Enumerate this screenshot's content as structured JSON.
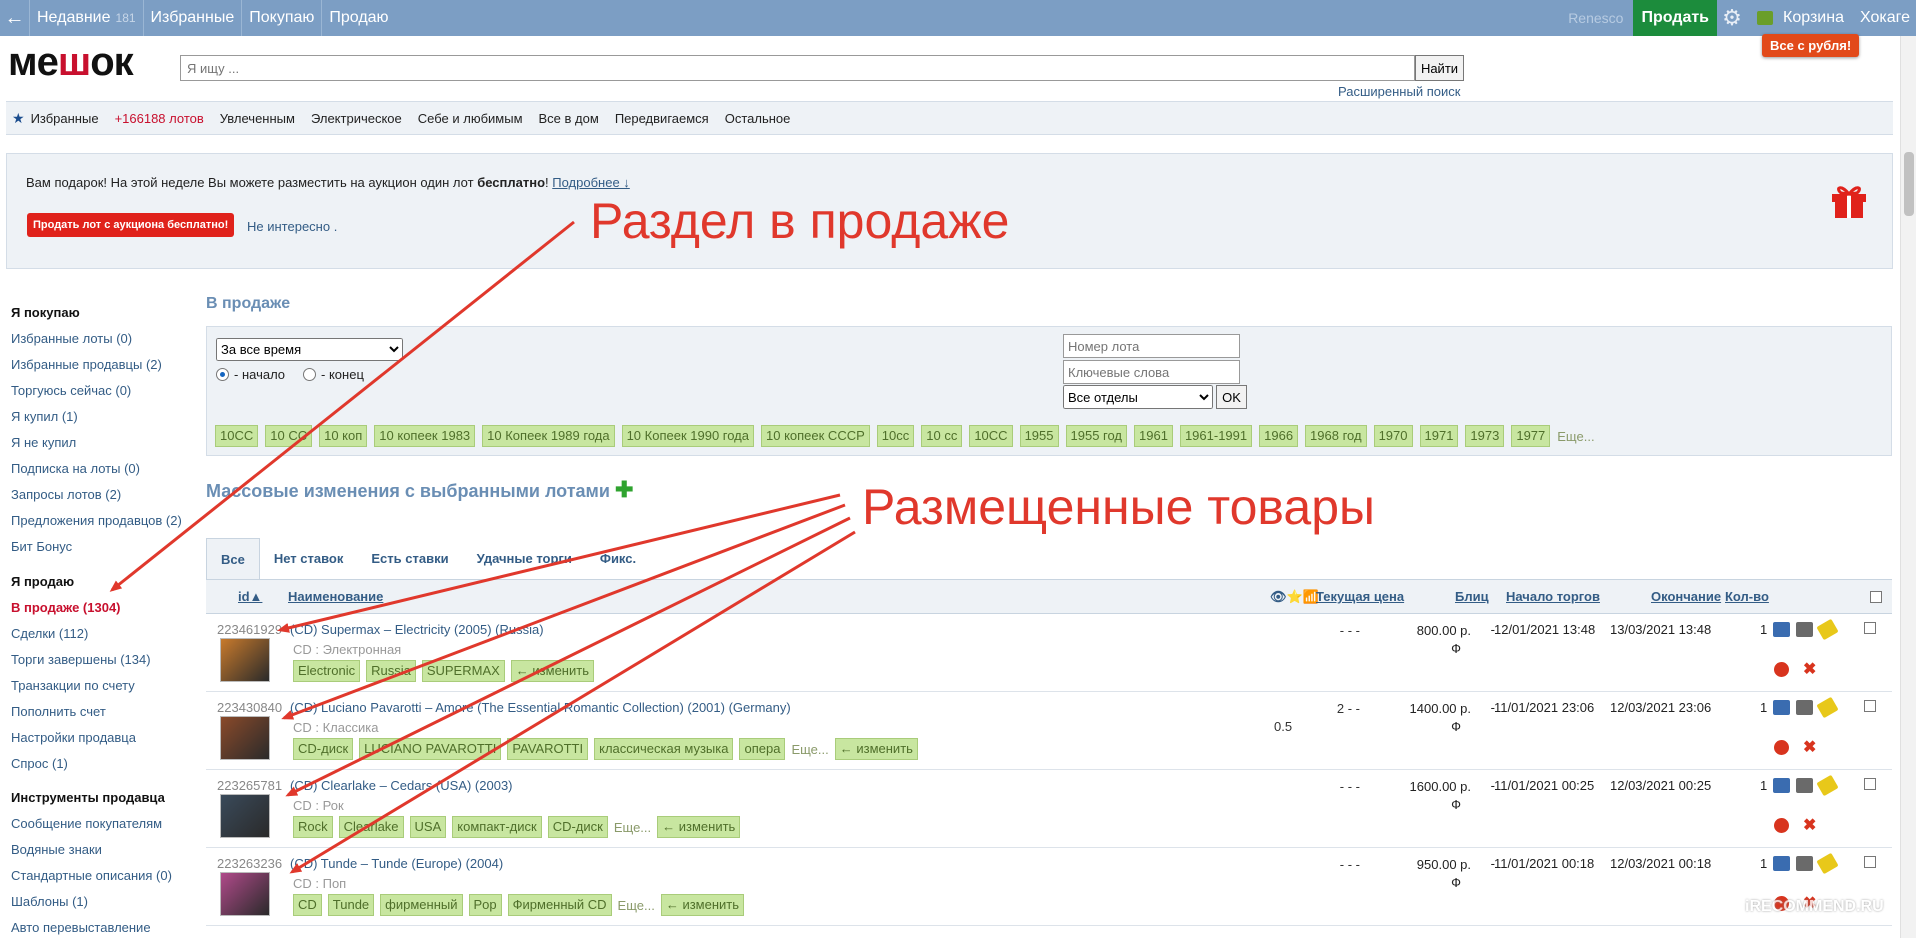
{
  "topbar": {
    "recent": "Недавние",
    "recent_count": "181",
    "favorites": "Избранные",
    "buying": "Покупаю",
    "selling": "Продаю",
    "user": "Renesco",
    "sell_button": "Продать",
    "cart": "Корзина",
    "xokare": "Хокаге"
  },
  "promo_badge": "Все с рубля!",
  "logo": {
    "pre": "ме",
    "mid": "ш",
    "post": "ок"
  },
  "search": {
    "placeholder": "Я ищу ...",
    "button": "Найти",
    "advanced": "Расширенный поиск"
  },
  "categories": {
    "favorites": "Избранные",
    "lots_count": "+166188 лотов",
    "items": [
      "Увлеченным",
      "Электрическое",
      "Себе и любимым",
      "Все в дом",
      "Передвигаемся",
      "Остальное"
    ]
  },
  "banner": {
    "text_a": "Вам подарок! На этой неделе Вы можете разместить на аукцион один лот ",
    "text_b": "бесплатно",
    "text_c": "! ",
    "more": "Подробнее ↓",
    "button": "Продать лот с аукциона бесплатно!",
    "not_interested": "Не интересно ."
  },
  "sidebar": {
    "buy_header": "Я покупаю",
    "buy_items": [
      "Избранные лоты (0)",
      "Избранные продавцы (2)",
      "Торгуюсь сейчас (0)",
      "Я купил (1)",
      "Я не купил",
      "Подписка на лоты (0)",
      "Запросы лотов (2)",
      "Предложения продавцов (2)",
      "Бит Бонус"
    ],
    "sell_header": "Я продаю",
    "sell_active": "В продаже (1304)",
    "sell_items": [
      "Сделки (112)",
      "Торги завершены (134)",
      "Транзакции по счету",
      "Пополнить счет",
      "Настройки продавца",
      "Спрос (1)"
    ],
    "tools_header": "Инструменты продавца",
    "tools_items": [
      "Сообщение покупателям",
      "Водяные знаки",
      "Стандартные описания (0)",
      "Шаблоны (1)",
      "Авто перевыставление"
    ]
  },
  "page_title": "В продаже",
  "filter": {
    "period": "За все время",
    "radio_start": "- начало",
    "radio_end": "- конец",
    "lot_placeholder": "Номер лота",
    "keywords_placeholder": "Ключевые слова",
    "dept": "Все отделы",
    "ok": "OK",
    "tags": [
      "10СС",
      "10 СС",
      "10 коп",
      "10 копеек 1983",
      "10 Копеек 1989 года",
      "10 Копеек 1990 года",
      "10 копеек СССР",
      "10сс",
      "10 сс",
      "10СС",
      "1955",
      "1955 год",
      "1961",
      "1961-1991",
      "1966",
      "1968 год",
      "1970",
      "1971",
      "1973",
      "1977"
    ],
    "more": "Еще..."
  },
  "mass_title": "Массовые изменения с выбранными лотами",
  "mass_plus": "✚",
  "tabs": [
    "Все",
    "Нет ставок",
    "Есть ставки",
    "Удачные торги",
    "Фикс."
  ],
  "table_header": {
    "id": "id▲",
    "name": "Наименование",
    "icons": "👁⭐📶",
    "price": "Текущая цена",
    "blitz": "Блиц",
    "start": "Начало торгов",
    "end": "Окончание",
    "qty": "Кол-во"
  },
  "rows": [
    {
      "id": "223461929",
      "name": "(CD) Supermax – Electricity (2005) (Russia)",
      "cat": "CD : Электронная",
      "tags": [
        "Electronic",
        "Russia",
        "SUPERMAX"
      ],
      "more": "",
      "edit": "← изменить",
      "stats": "-  -  -",
      "stats2": "",
      "price": "800.00 р.",
      "cur": "Ф",
      "blitz": "-",
      "start": "12/01/2021 13:48",
      "end": "13/03/2021 13:48",
      "qty": "1",
      "thumb": "#c87a2c"
    },
    {
      "id": "223430840",
      "name": "(CD) Luciano Pavarotti – Amore (The Essential Romantic Collection) (2001) (Germany)",
      "cat": "CD : Классика",
      "tags": [
        "CD-диск",
        "LUCIANO PAVAROTTI",
        "PAVAROTTI",
        "классическая музыка",
        "опера"
      ],
      "more": "Еще...",
      "edit": "← изменить",
      "stats": "2  -  -",
      "stats2": "0.5",
      "price": "1400.00 р.",
      "cur": "Ф",
      "blitz": "-",
      "start": "11/01/2021 23:06",
      "end": "12/03/2021 23:06",
      "qty": "1",
      "thumb": "#8a4a2a"
    },
    {
      "id": "223265781",
      "name": "(CD) Clearlake – Cedars (USA) (2003)",
      "cat": "CD : Рок",
      "tags": [
        "Rock",
        "Clearlake",
        "USA",
        "компакт-диск",
        "CD-диск"
      ],
      "more": "Еще...",
      "edit": "← изменить",
      "stats": "-  -  -",
      "stats2": "",
      "price": "1600.00 р.",
      "cur": "Ф",
      "blitz": "-",
      "start": "11/01/2021 00:25",
      "end": "12/03/2021 00:25",
      "qty": "1",
      "thumb": "#3a4a5a"
    },
    {
      "id": "223263236",
      "name": "(CD) Tunde – Tunde (Europe) (2004)",
      "cat": "CD : Поп",
      "tags": [
        "CD",
        "Tunde",
        "фирменный",
        "Pop",
        "Фирменный CD"
      ],
      "more": "Еще...",
      "edit": "← изменить",
      "stats": "-  -  -",
      "stats2": "",
      "price": "950.00 р.",
      "cur": "Ф",
      "blitz": "-",
      "start": "11/01/2021 00:18",
      "end": "12/03/2021 00:18",
      "qty": "1",
      "thumb": "#b04a8a"
    }
  ],
  "annotations": {
    "section": "Раздел в продаже",
    "items": "Размещенные товары"
  },
  "watermark": "iRECOMMEND.RU"
}
